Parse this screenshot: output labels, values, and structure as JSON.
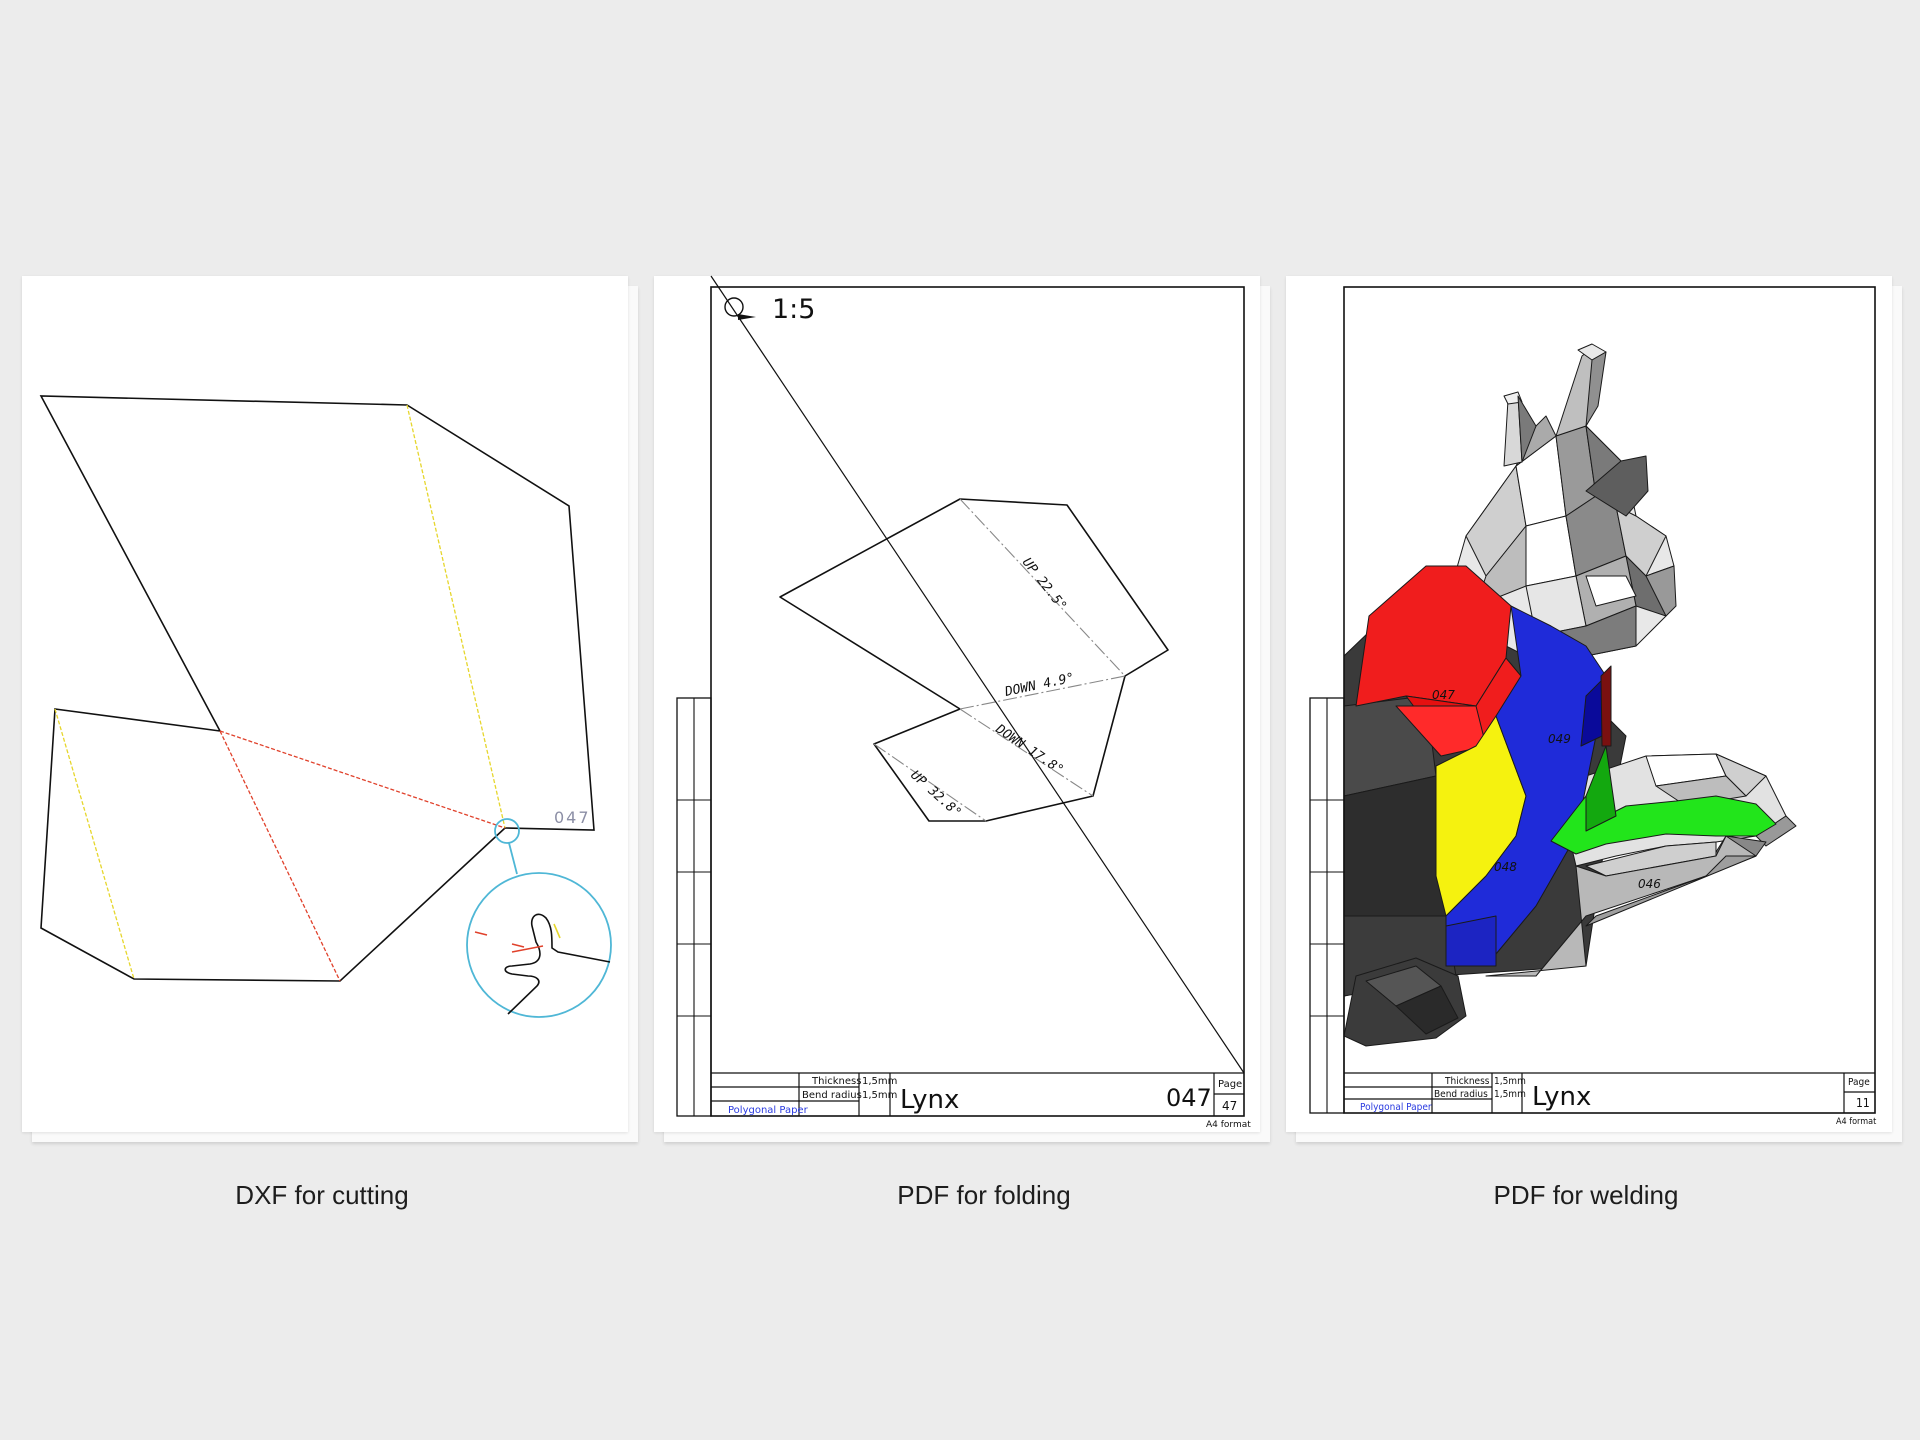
{
  "captions": {
    "dxf": "DXF for cutting",
    "fold": "PDF for folding",
    "weld": "PDF for welding"
  },
  "dxf_sheet": {
    "part_number": "047"
  },
  "fold_sheet": {
    "scale": "1:5",
    "bend_labels": [
      "UP 22.5°",
      "DOWN 4.9°",
      "DOWN 17.8°",
      "UP 32.8°"
    ],
    "title_block": {
      "thickness_label": "Thickness",
      "thickness_value": "1,5mm",
      "bend_radius_label": "Bend radius",
      "bend_radius_value": "1,5mm",
      "brand": "Polygonal Paper",
      "model": "Lynx",
      "part_number": "047",
      "page_label": "Page",
      "page_number": "47",
      "format": "A4 format"
    }
  },
  "weld_sheet": {
    "part_labels": [
      "047",
      "049",
      "048",
      "046"
    ],
    "title_block": {
      "thickness_label": "Thickness",
      "thickness_value": "1,5mm",
      "bend_radius_label": "Bend radius",
      "bend_radius_value": "1,5mm",
      "brand": "Polygonal Paper",
      "model": "Lynx",
      "page_label": "Page",
      "page_number": "11",
      "format": "A4 format"
    }
  },
  "colors": {
    "background": "#ececec",
    "cut_line": "#111111",
    "fold_red": "#e0412b",
    "fold_yellow": "#e6d62c",
    "detail_blue": "#4fb7d6",
    "part_red": "#f01d1d",
    "part_blue": "#1f2bd9",
    "part_yellow": "#f5f20f",
    "part_green": "#22e51b",
    "brand_blue": "#2a3be0"
  }
}
